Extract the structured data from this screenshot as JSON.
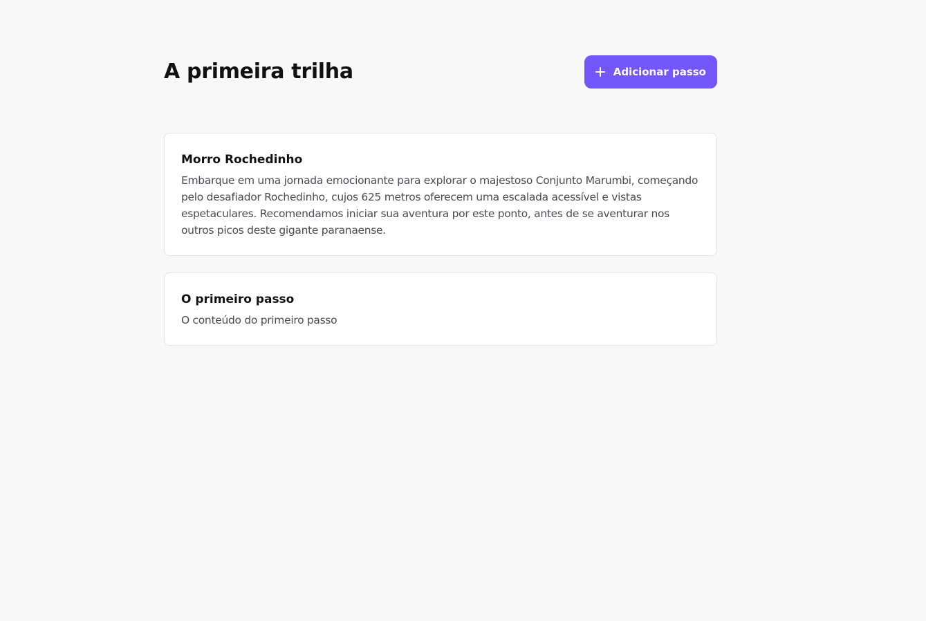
{
  "header": {
    "title": "A primeira trilha",
    "add_button_label": "Adicionar passo",
    "add_button_icon": "plus-icon"
  },
  "colors": {
    "background": "#f8f8f8",
    "accent": "#7357fb",
    "card_border": "#e5e5e8",
    "body_text": "#4b4a57"
  },
  "steps": [
    {
      "title": "Morro Rochedinho",
      "content": "Embarque em uma jornada emocionante para explorar o majestoso Conjunto Marumbi, começando pelo desafiador Rochedinho, cujos 625 metros oferecem uma escalada acessível e vistas espetaculares. Recomendamos iniciar sua aventura por este ponto, antes de se aventurar nos outros picos deste gigante paranaense."
    },
    {
      "title": "O primeiro passo",
      "content": "O conteúdo do primeiro passo"
    }
  ]
}
